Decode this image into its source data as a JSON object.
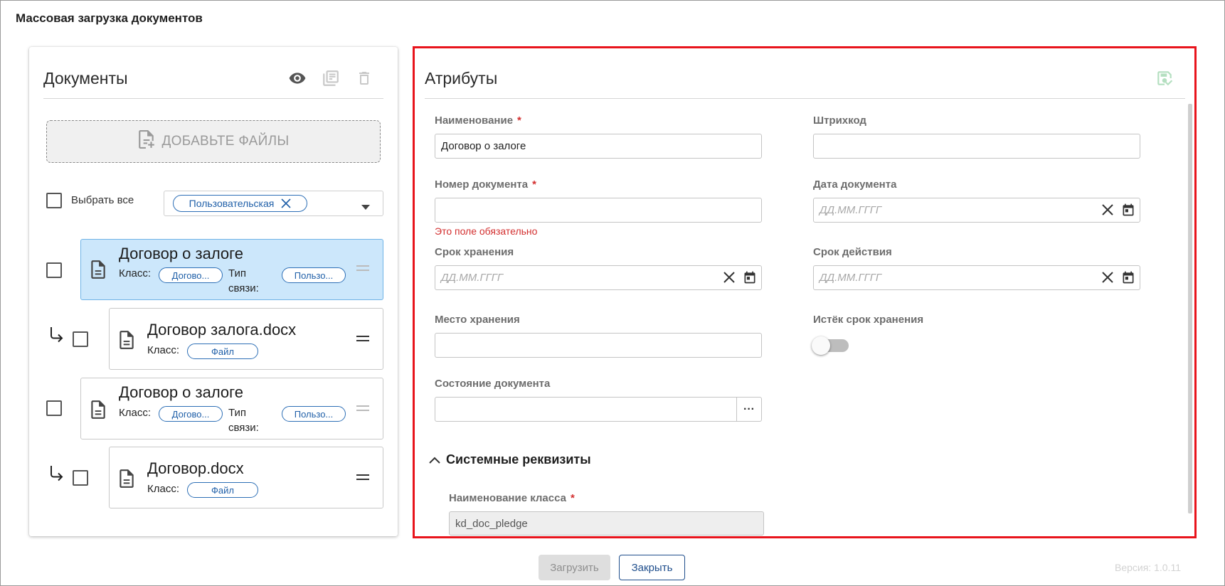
{
  "window": {
    "title": "Массовая загрузка документов"
  },
  "documents_panel": {
    "title": "Документы",
    "toolbar": [
      "eye-icon",
      "copy-list-icon",
      "trash-icon"
    ],
    "add_files_label": "ДОБАВЬТЕ ФАЙЛЫ",
    "select_all_label": "Выбрать все",
    "filter_chip": "Пользовательская",
    "items": [
      {
        "name": "Договор о залоге",
        "class_label": "Класс:",
        "class_value": "Догово...",
        "link_label": "Тип связи:",
        "link_label_1": "Тип",
        "link_label_2": "связи:",
        "link_value": "Пользо...",
        "selected": true
      },
      {
        "name": "Договор залога.docx",
        "class_label": "Класс:",
        "class_value": "Файл"
      },
      {
        "name": "Договор о залоге",
        "class_label": "Класс:",
        "class_value": "Догово...",
        "link_label_1": "Тип",
        "link_label_2": "связи:",
        "link_value": "Пользо...",
        "selected": false
      },
      {
        "name": "Договор.docx",
        "class_label": "Класс:",
        "class_value": "Файл"
      }
    ]
  },
  "attributes_panel": {
    "title": "Атрибуты",
    "fields": {
      "name": {
        "label": "Наименование",
        "value": "Договор о залоге",
        "required": "*"
      },
      "barcode": {
        "label": "Штрихкод",
        "value": ""
      },
      "doc_number": {
        "label": "Номер документа",
        "value": "",
        "required": "*",
        "error": "Это поле обязательно"
      },
      "doc_date": {
        "label": "Дата документа",
        "placeholder": "ДД.ММ.ГГГГ"
      },
      "storage_term": {
        "label": "Срок хранения",
        "placeholder": "ДД.ММ.ГГГГ"
      },
      "validity_term": {
        "label": "Срок действия",
        "placeholder": "ДД.ММ.ГГГГ"
      },
      "storage_place": {
        "label": "Место хранения",
        "value": ""
      },
      "expired": {
        "label": "Истёк срок хранения",
        "checked": false
      },
      "doc_state": {
        "label": "Состояние документа",
        "value": "",
        "button": "···"
      }
    },
    "system_section": {
      "title": "Системные реквизиты",
      "class_name": {
        "label": "Наименование класса",
        "value": "kd_doc_pledge",
        "required": "*"
      }
    }
  },
  "footer": {
    "upload_label": "Загрузить",
    "close_label": "Закрыть",
    "version": "Версия: 1.0.11"
  },
  "colors": {
    "accent": "#1f4e8c",
    "chip": "#2d6fb6",
    "error": "#d32f2f",
    "highlight_border": "#e8141c",
    "selected_row": "#cce7fb"
  }
}
